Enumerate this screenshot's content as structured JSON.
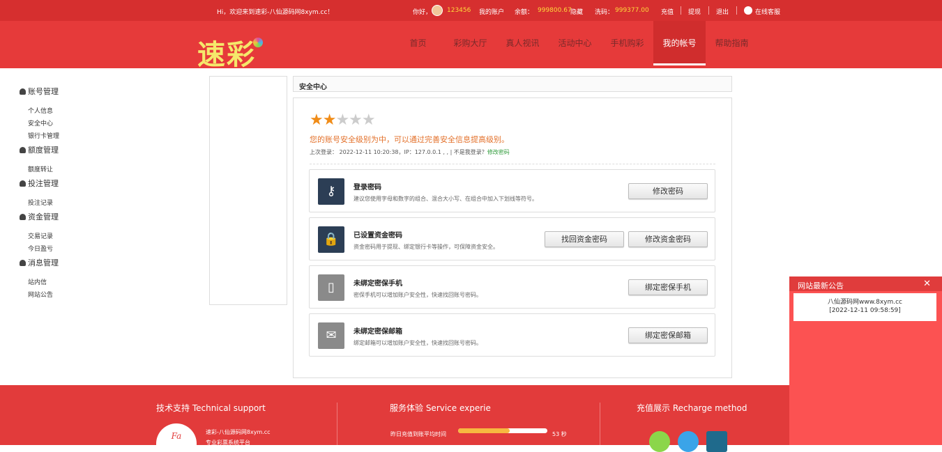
{
  "topbar": {
    "greeting": "Hi，欢迎来到速彩-八仙源码网8xym.cc！",
    "hello": "你好，",
    "username": "123456",
    "my_account": "我的账户",
    "balance_label": "余额：",
    "balance_value": "999800.67",
    "hide": "隐藏",
    "wash_label": "洗码：",
    "wash_value": "999377.00",
    "recharge": "充值",
    "withdraw": "提现",
    "logout": "退出",
    "online_service": "在线客服"
  },
  "logo": {
    "text": "速彩"
  },
  "nav": [
    {
      "label": "首页"
    },
    {
      "label": "彩购大厅"
    },
    {
      "label": "真人视讯"
    },
    {
      "label": "活动中心"
    },
    {
      "label": "手机购彩"
    },
    {
      "label": "我的帐号"
    },
    {
      "label": "帮助指南"
    }
  ],
  "sidebar": {
    "account_mgmt": "账号管理",
    "personal_info": "个人信息",
    "security_center": "安全中心",
    "bank_card_mgmt": "银行卡管理",
    "quota_mgmt": "额度管理",
    "quota_transfer": "额度转让",
    "bet_mgmt": "投注管理",
    "bet_records": "投注记录",
    "fund_mgmt": "资金管理",
    "transaction_records": "交易记录",
    "today_pnl": "今日盈亏",
    "message_mgmt": "消息管理",
    "inbox": "站内信",
    "site_notice": "网站公告"
  },
  "panel": {
    "title": "安全中心",
    "stars_on": "★★",
    "stars_off": "★★★",
    "level_message": "您的账号安全级别为中，可以通过完善安全信息提高级别。",
    "last_login": "上次登录： 2022-12-11 10:20:38，IP：127.0.0.1 , , | 不是我登录？",
    "change_password_link": "修改密码"
  },
  "cards": {
    "login_pwd_title": "登录密码",
    "login_pwd_desc": "建议您使用字母和数字的组合、混合大小写、在组合中加入下划线等符号。",
    "login_pwd_btn": "修改密码",
    "fund_pwd_title": "已设置资金密码",
    "fund_pwd_desc": "资金密码用于提现、绑定银行卡等操作，可保障资金安全。",
    "fund_pwd_recover_btn": "找回资金密码",
    "fund_pwd_change_btn": "修改资金密码",
    "phone_title": "未绑定密保手机",
    "phone_desc": "密保手机可以增加账户安全性，快速找回账号密码。",
    "phone_btn": "绑定密保手机",
    "email_title": "未绑定密保邮箱",
    "email_desc": "绑定邮箱可以增加账户安全性，快速找回账号密码。",
    "email_btn": "绑定密保邮箱"
  },
  "footer": {
    "tech_support": "技术支持 Technical support",
    "service": "服务体验 Service experie",
    "recharge_method": "充值展示 Recharge method",
    "brand_line": "速彩-八仙源码网8xym.cc",
    "brand_tagline": "专业彩票系统平台",
    "avg_time_label": "昨日充值到账平均时间",
    "avg_time_value": "53 秒",
    "avg_time_fraction": 0.58
  },
  "notice": {
    "title": "网站最新公告",
    "close": "✕",
    "line1": "八仙源码网www.8xym.cc",
    "line2": "[2022-12-11 09:58:59]"
  }
}
